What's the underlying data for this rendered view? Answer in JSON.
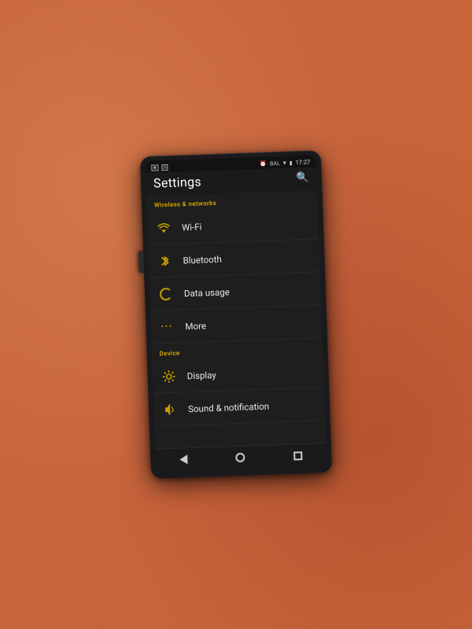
{
  "device": {
    "status_bar": {
      "left_icons": [
        "tv",
        "sd-card"
      ],
      "right_label": "BAL",
      "time": "17:27"
    },
    "header": {
      "title": "Settings",
      "search_label": "🔍"
    },
    "sections": [
      {
        "id": "wireless",
        "label": "Wireless & networks",
        "items": [
          {
            "id": "wifi",
            "icon": "wifi",
            "label": "Wi-Fi"
          },
          {
            "id": "bluetooth",
            "icon": "bluetooth",
            "label": "Bluetooth"
          },
          {
            "id": "data-usage",
            "icon": "data",
            "label": "Data usage"
          },
          {
            "id": "more",
            "icon": "more",
            "label": "More"
          }
        ]
      },
      {
        "id": "device",
        "label": "Device",
        "items": [
          {
            "id": "display",
            "icon": "display",
            "label": "Display"
          },
          {
            "id": "sound",
            "icon": "sound",
            "label": "Sound & notification"
          }
        ]
      }
    ],
    "nav_bar": {
      "back_label": "◁",
      "home_label": "○",
      "recent_label": "□"
    }
  }
}
